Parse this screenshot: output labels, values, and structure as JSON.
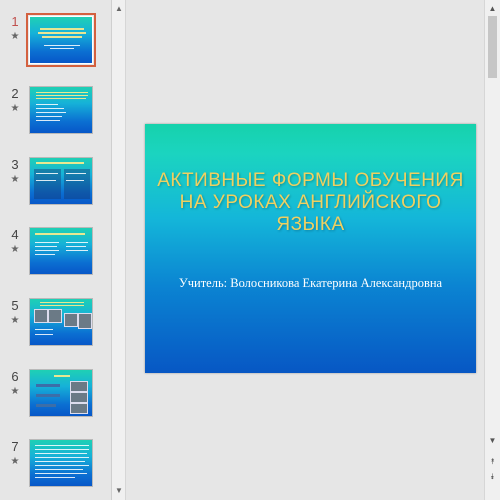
{
  "slides": [
    {
      "number": "1",
      "mark": "★",
      "selected": true
    },
    {
      "number": "2",
      "mark": "★",
      "selected": false
    },
    {
      "number": "3",
      "mark": "★",
      "selected": false
    },
    {
      "number": "4",
      "mark": "★",
      "selected": false
    },
    {
      "number": "5",
      "mark": "★",
      "selected": false
    },
    {
      "number": "6",
      "mark": "★",
      "selected": false
    },
    {
      "number": "7",
      "mark": "★",
      "selected": false
    }
  ],
  "current_slide": {
    "title": "АКТИВНЫЕ ФОРМЫ ОБУЧЕНИЯ НА УРОКАХ АНГЛИЙСКОГО ЯЗЫКА",
    "subtitle": "Учитель: Волосникова Екатерина Александровна"
  },
  "scrollbar": {
    "up": "▲",
    "down": "▼",
    "prev": "⯭",
    "next": "⯯"
  },
  "colors": {
    "accent": "#d3603f",
    "title": "#f0d060"
  }
}
